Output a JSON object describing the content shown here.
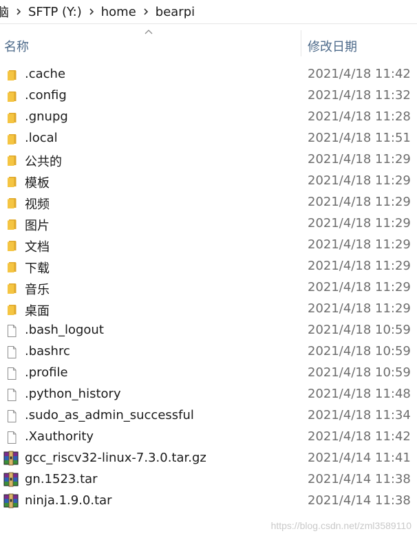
{
  "breadcrumb": {
    "items": [
      "脑",
      "SFTP (Y:)",
      "home",
      "bearpi"
    ]
  },
  "columns": {
    "name": "名称",
    "date": "修改日期"
  },
  "rows": [
    {
      "type": "folder",
      "name": ".cache",
      "date": "2021/4/18 11:42"
    },
    {
      "type": "folder",
      "name": ".config",
      "date": "2021/4/18 11:32"
    },
    {
      "type": "folder",
      "name": ".gnupg",
      "date": "2021/4/18 11:28"
    },
    {
      "type": "folder",
      "name": ".local",
      "date": "2021/4/18 11:51"
    },
    {
      "type": "folder",
      "name": "公共的",
      "date": "2021/4/18 11:29"
    },
    {
      "type": "folder",
      "name": "模板",
      "date": "2021/4/18 11:29"
    },
    {
      "type": "folder",
      "name": "视频",
      "date": "2021/4/18 11:29"
    },
    {
      "type": "folder",
      "name": "图片",
      "date": "2021/4/18 11:29"
    },
    {
      "type": "folder",
      "name": "文档",
      "date": "2021/4/18 11:29"
    },
    {
      "type": "folder",
      "name": "下载",
      "date": "2021/4/18 11:29"
    },
    {
      "type": "folder",
      "name": "音乐",
      "date": "2021/4/18 11:29"
    },
    {
      "type": "folder",
      "name": "桌面",
      "date": "2021/4/18 11:29"
    },
    {
      "type": "file",
      "name": ".bash_logout",
      "date": "2021/4/18 10:59"
    },
    {
      "type": "file",
      "name": ".bashrc",
      "date": "2021/4/18 10:59"
    },
    {
      "type": "file",
      "name": ".profile",
      "date": "2021/4/18 10:59"
    },
    {
      "type": "file",
      "name": ".python_history",
      "date": "2021/4/18 11:48"
    },
    {
      "type": "file",
      "name": ".sudo_as_admin_successful",
      "date": "2021/4/18 11:34"
    },
    {
      "type": "file",
      "name": ".Xauthority",
      "date": "2021/4/18 11:42"
    },
    {
      "type": "archive",
      "name": "gcc_riscv32-linux-7.3.0.tar.gz",
      "date": "2021/4/14 11:41"
    },
    {
      "type": "archive",
      "name": "gn.1523.tar",
      "date": "2021/4/14 11:38"
    },
    {
      "type": "archive",
      "name": "ninja.1.9.0.tar",
      "date": "2021/4/14 11:38"
    }
  ],
  "icons": {
    "folder": "folder-icon",
    "file": "file-icon",
    "archive": "archive-icon",
    "separator": "chevron-right-icon",
    "sort": "sort-ascending-icon"
  },
  "colors": {
    "folder": "#f5c542",
    "header_text": "#4d6a8a",
    "date_text": "#6d6d6d"
  },
  "watermark": "https://blog.csdn.net/zml3589110"
}
